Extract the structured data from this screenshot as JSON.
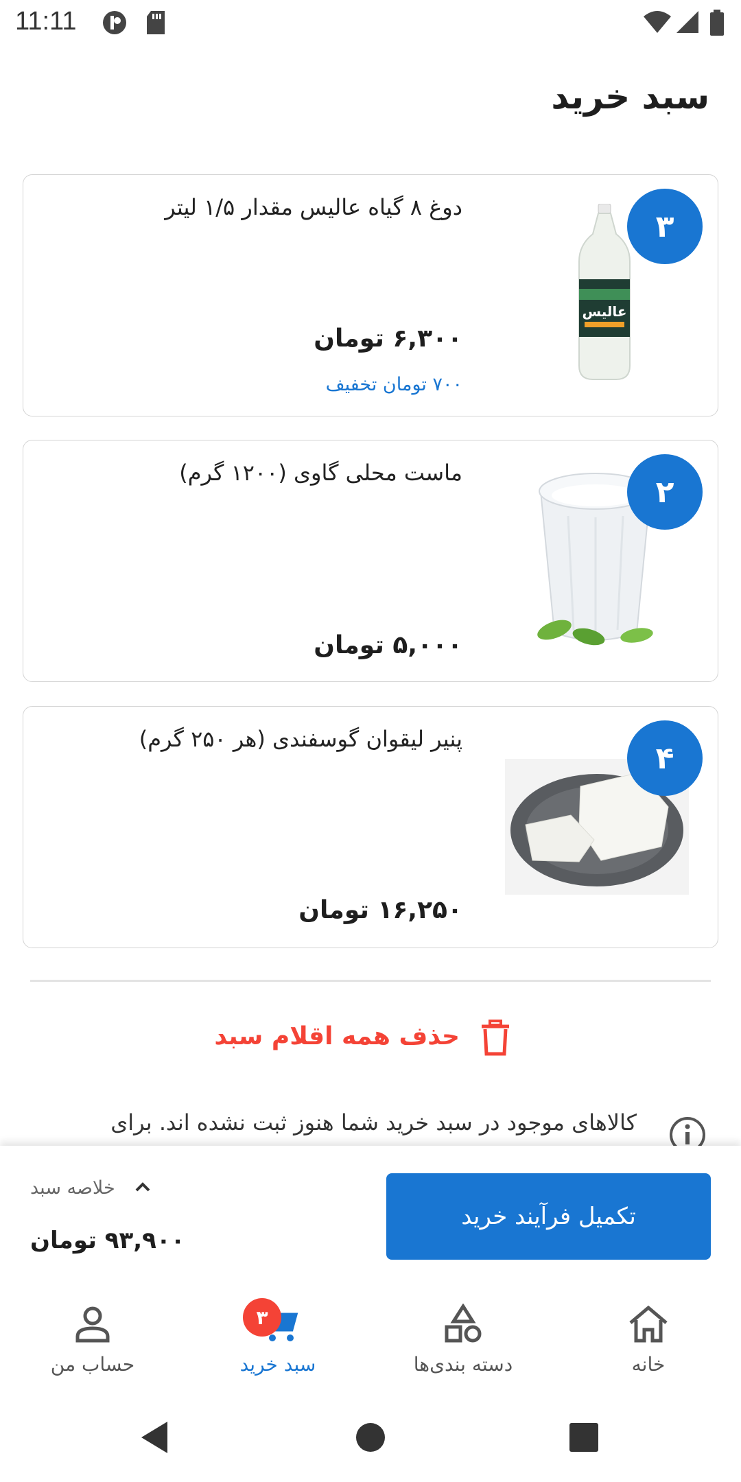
{
  "status_bar": {
    "time": "11:11"
  },
  "page": {
    "title": "سبد خرید"
  },
  "cart_items": [
    {
      "qty": "۳",
      "name": "دوغ ۸ گیاه عالیس مقدار ۱/۵ لیتر",
      "price": "۶,۳۰۰ تومان",
      "discount": "۷۰۰ تومان تخفیف",
      "image": "doogh-bottle-image"
    },
    {
      "qty": "۲",
      "name": "ماست محلی گاوی (۱۲۰۰ گرم)",
      "price": "۵,۰۰۰ تومان",
      "image": "yogurt-cup-image"
    },
    {
      "qty": "۴",
      "name": "پنیر لیقوان گوسفندی (هر ۲۵۰ گرم)",
      "price": "۱۶,۲۵۰ تومان",
      "image": "cheese-plate-image"
    }
  ],
  "actions": {
    "delete_all": "حذف همه اقلام سبد"
  },
  "info": {
    "text": "کالاهای موجود در سبد خرید شما هنوز ثبت نشده اند. برای"
  },
  "checkout": {
    "summary_label": "خلاصه سبد",
    "total": "۹۳,۹۰۰ تومان",
    "button": "تکمیل فرآیند خرید"
  },
  "bottom_nav": {
    "home": "خانه",
    "categories": "دسته بندی‌ها",
    "cart": "سبد خرید",
    "cart_badge": "۳",
    "account": "حساب من"
  },
  "colors": {
    "primary": "#1976d2",
    "danger": "#f44336"
  }
}
